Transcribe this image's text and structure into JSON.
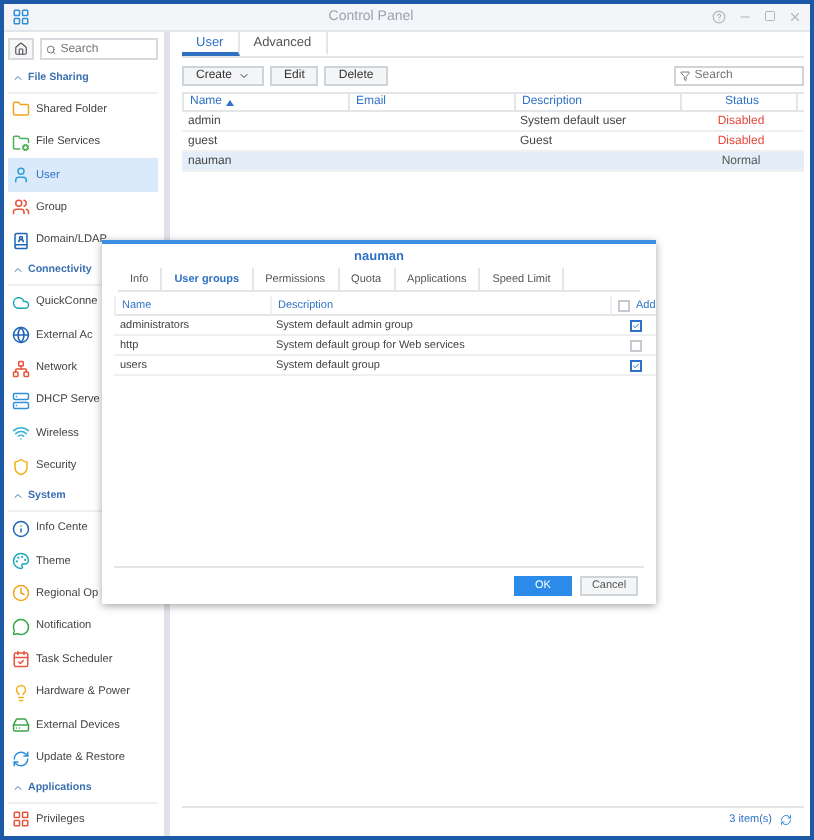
{
  "window": {
    "title": "Control Panel"
  },
  "sidebar": {
    "search": {
      "placeholder": "Search"
    },
    "sections": [
      {
        "title": "File Sharing",
        "expanded": true,
        "items": [
          {
            "label": "Shared Folder",
            "selected": false
          },
          {
            "label": "File Services",
            "selected": false
          },
          {
            "label": "User",
            "selected": true
          },
          {
            "label": "Group",
            "selected": false
          },
          {
            "label": "Domain/LDAP",
            "selected": false
          }
        ]
      },
      {
        "title": "Connectivity",
        "expanded": true,
        "items": [
          {
            "label": "QuickConne",
            "selected": false
          },
          {
            "label": "External Ac",
            "selected": false
          },
          {
            "label": "Network",
            "selected": false
          },
          {
            "label": "DHCP Serve",
            "selected": false
          },
          {
            "label": "Wireless",
            "selected": false
          },
          {
            "label": "Security",
            "selected": false
          }
        ]
      },
      {
        "title": "System",
        "expanded": true,
        "items": [
          {
            "label": "Info Cente",
            "selected": false
          },
          {
            "label": "Theme",
            "selected": false
          },
          {
            "label": "Regional Op",
            "selected": false
          },
          {
            "label": "Notification",
            "selected": false
          },
          {
            "label": "Task Scheduler",
            "selected": false
          },
          {
            "label": "Hardware & Power",
            "selected": false
          },
          {
            "label": "External Devices",
            "selected": false
          },
          {
            "label": "Update & Restore",
            "selected": false
          }
        ]
      },
      {
        "title": "Applications",
        "expanded": true,
        "items": [
          {
            "label": "Privileges",
            "selected": false
          }
        ]
      }
    ]
  },
  "tabs": [
    {
      "label": "User",
      "selected": true
    },
    {
      "label": "Advanced",
      "selected": false
    }
  ],
  "toolbar": {
    "buttons": [
      {
        "label": "Create",
        "kind": "split"
      },
      {
        "label": "Edit",
        "kind": "plain"
      },
      {
        "label": "Delete",
        "kind": "plain"
      }
    ],
    "search": {
      "placeholder": "Search"
    }
  },
  "table": {
    "columns": [
      {
        "label": "Name",
        "sorted": true
      },
      {
        "label": "Email",
        "sorted": false
      },
      {
        "label": "Description",
        "sorted": false
      },
      {
        "label": "Status",
        "sorted": false
      }
    ],
    "rows": [
      {
        "name": "admin",
        "description": "System default user",
        "status": "Disabled",
        "kind": "disabled",
        "selected": false
      },
      {
        "name": "guest",
        "description": "Guest",
        "status": "Disabled",
        "kind": "disabled",
        "selected": false
      },
      {
        "name": "nauman",
        "description": "",
        "status": "Normal",
        "kind": "normal",
        "selected": true
      }
    ]
  },
  "status_bar": {
    "count": "3 item(s)"
  },
  "dialog": {
    "title": "nauman",
    "tabs": [
      {
        "label": "Info",
        "selected": false
      },
      {
        "label": "User groups",
        "selected": true
      },
      {
        "label": "Permissions",
        "selected": false
      },
      {
        "label": "Quota",
        "selected": false
      },
      {
        "label": "Applications",
        "selected": false
      },
      {
        "label": "Speed Limit",
        "selected": false
      }
    ],
    "columns": [
      {
        "label": "Name"
      },
      {
        "label": "Description"
      },
      {
        "label": "Add",
        "checked": false
      }
    ],
    "rows": [
      {
        "name": "administrators",
        "description": "System default admin group",
        "checked": true
      },
      {
        "name": "http",
        "description": "System default group for Web services",
        "checked": false
      },
      {
        "name": "users",
        "description": "System default group",
        "checked": true
      }
    ],
    "buttons": [
      {
        "label": "OK",
        "kind": "primary"
      },
      {
        "label": "Cancel",
        "kind": "secondary"
      }
    ]
  }
}
